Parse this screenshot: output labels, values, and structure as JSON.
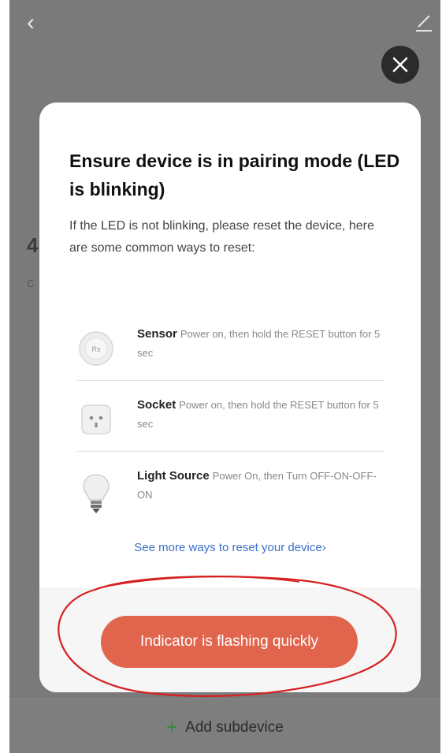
{
  "background": {
    "partial_heading": "4",
    "partial_sub": "C",
    "add_subdevice_label": "Add subdevice"
  },
  "modal": {
    "title": "Ensure device is in pairing mode (LED is blinking)",
    "description": "If the LED is not blinking, please reset the device, here are some common ways to reset:",
    "items": [
      {
        "name": "Sensor",
        "instruction": "Power on, then hold the RESET button for 5 sec",
        "icon": "sensor-icon"
      },
      {
        "name": "Socket",
        "instruction": "Power on, then hold the RESET button for 5 sec",
        "icon": "socket-icon"
      },
      {
        "name": "Light Source",
        "instruction": "Power On, then Turn OFF-ON-OFF-ON",
        "icon": "bulb-icon"
      }
    ],
    "more_link": "See more ways to reset your device›",
    "confirm_button": "Indicator is flashing quickly"
  },
  "colors": {
    "accent_button": "#e0654c",
    "link": "#3a70c8",
    "annotation": "#d62020",
    "add_icon": "#2f8a3a"
  }
}
